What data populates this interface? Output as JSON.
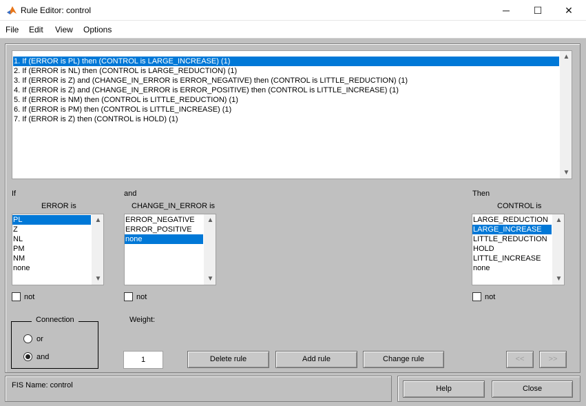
{
  "window": {
    "title": "Rule Editor: control",
    "minimize": "─",
    "maximize": "☐",
    "close": "✕"
  },
  "menu": [
    "File",
    "Edit",
    "View",
    "Options"
  ],
  "rules": [
    "1. If (ERROR is PL) then (CONTROL is LARGE_INCREASE) (1)",
    "2. If (ERROR is NL) then (CONTROL is LARGE_REDUCTION) (1)",
    "3. If (ERROR is Z) and (CHANGE_IN_ERROR is ERROR_NEGATIVE) then (CONTROL is LITTLE_REDUCTION) (1)",
    "4. If (ERROR is Z) and (CHANGE_IN_ERROR is ERROR_POSITIVE) then (CONTROL is LITTLE_INCREASE) (1)",
    "5. If (ERROR is NM) then (CONTROL is LITTLE_REDUCTION) (1)",
    "6. If (ERROR is PM) then (CONTROL is LITTLE_INCREASE) (1)",
    "7. If (ERROR is Z) then (CONTROL is HOLD) (1)"
  ],
  "if_section": {
    "label": "If",
    "var_label": "ERROR is",
    "options": [
      "PL",
      "Z",
      "NL",
      "PM",
      "NM",
      "none"
    ],
    "selected": 0,
    "not_label": "not"
  },
  "and_section": {
    "label": "and",
    "var_label": "CHANGE_IN_ERROR is",
    "options": [
      "ERROR_NEGATIVE",
      "ERROR_POSITIVE",
      "none"
    ],
    "selected": 2,
    "not_label": "not"
  },
  "then_section": {
    "label": "Then",
    "var_label": "CONTROL is",
    "options": [
      "LARGE_REDUCTION",
      "LARGE_INCREASE",
      "LITTLE_REDUCTION",
      "HOLD",
      "LITTLE_INCREASE",
      "none"
    ],
    "selected": 1,
    "not_label": "not"
  },
  "connection": {
    "label": "Connection",
    "or_label": "or",
    "and_label": "and",
    "selected": "and"
  },
  "weight": {
    "label": "Weight:",
    "value": "1"
  },
  "buttons": {
    "delete": "Delete rule",
    "add": "Add rule",
    "change": "Change rule",
    "prev": "<<",
    "next": ">>",
    "help": "Help",
    "close": "Close"
  },
  "status": "FIS Name: control",
  "colors": {
    "selection": "#0078d7",
    "background": "#c0c0c0"
  }
}
